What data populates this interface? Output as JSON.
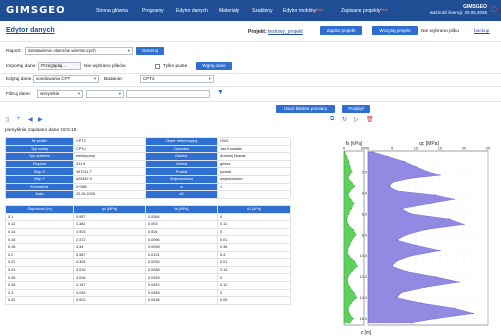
{
  "nav": {
    "logo": "GIMSGEO",
    "items": [
      {
        "label": "Strona główna",
        "badge": ""
      },
      {
        "label": "Programy",
        "badge": ""
      },
      {
        "label": "Edytor danych",
        "badge": ""
      },
      {
        "label": "Materiały",
        "badge": ""
      },
      {
        "label": "Szablony",
        "badge": ""
      },
      {
        "label": "Edytor mobilny",
        "badge": "Beta"
      },
      {
        "label": "Zapisane projekty",
        "badge": "Beta"
      }
    ],
    "brand_name": "GIMSGEO",
    "brand_sub": "ważność licencji: 20.06.2026"
  },
  "page": {
    "title": "Edytor danych",
    "project_label": "Projekt:",
    "project_name": "testowy_projekt",
    "save_button": "Zapisz projekt",
    "load_button": "Wczytaj projekt",
    "no_file": "Nie wybrano pliku",
    "backup": "backup"
  },
  "report": {
    "label": "Raport:",
    "value": "Zestawienie otworów wiertniczych",
    "generate": "Generuj"
  },
  "import": {
    "label": "Importuj dane:",
    "browse": "Przeglądaj...",
    "no_files": "Nie wybrano plików.",
    "only_empty": "Tylko puste",
    "load": "Wgraj dane"
  },
  "edit": {
    "label": "Edytuj dane:",
    "value": "sondowania CPT",
    "research_label": "Badanie:",
    "research_value": "CPT2"
  },
  "filter": {
    "label": "Filtruj dane:",
    "value": "wszystkie",
    "second": ""
  },
  "actions": {
    "remove_errors": "Usuń błędne pomiary",
    "sublayer": "Podpięł"
  },
  "icons": [
    "file-icon",
    "plus-icon",
    "arrow-left-icon",
    "arrow-right-icon",
    "copy-icon",
    "refresh-icon",
    "play-icon",
    "trash-icon"
  ],
  "saved_status": "pomyślnie zapisano dane 19:5:19",
  "info_table": [
    [
      "Nr profilu",
      "CPT2",
      "Otwór referencyjny",
      "OW1"
    ],
    [
      "Typ sondy",
      "CPTu",
      "Operator",
      "Jan Kowalski"
    ],
    [
      "Typ systemu",
      "elektryczny",
      "Nadzór",
      "Andrzej Nowak"
    ],
    [
      "Rzędna",
      "311.9",
      "Gmina",
      "gmina"
    ],
    [
      "Wsp X",
      "497011.7",
      "Powiat",
      "powiat"
    ],
    [
      "Wsp Y",
      "629487.9",
      "Województwo",
      "województwo"
    ],
    [
      "Kilometraż",
      "0+565",
      "a",
      "1"
    ],
    [
      "Data",
      "20.06.2028",
      "α0",
      ""
    ]
  ],
  "data_table": {
    "headers": [
      "Głębokość [m]",
      "qc [MPa]",
      "fs [MPa]",
      "u2 [kPa]"
    ],
    "rows": [
      [
        "0.1",
        "0.957",
        "0.0084",
        "0"
      ],
      [
        "0.12",
        "1.382",
        "0.003",
        "0.11"
      ],
      [
        "0.14",
        "1.903",
        "0.004",
        "0"
      ],
      [
        "0.16",
        "2.472",
        "0.0066",
        "0.01"
      ],
      [
        "0.18",
        "3.34",
        "0.0098",
        "0.35"
      ],
      [
        "0.2",
        "3.987",
        "0.0131",
        "0.4"
      ],
      [
        "0.22",
        "4.304",
        "0.0254",
        "0.01"
      ],
      [
        "0.24",
        "4.516",
        "0.0288",
        "0.13"
      ],
      [
        "0.26",
        "4.516",
        "0.0326",
        "0"
      ],
      [
        "0.28",
        "4.157",
        "0.0492",
        "0.12"
      ],
      [
        "0.3",
        "4.045",
        "0.0456",
        "0"
      ],
      [
        "0.32",
        "3.922",
        "0.0436",
        "0.05"
      ]
    ]
  },
  "chart_data": {
    "type": "area",
    "fs_label": "fs [kPa]",
    "qc_label": "qc [MPa]",
    "ylabel": "z [m]",
    "fs_ticks": [
      "0",
      "300"
    ],
    "qc_ticks": [
      "0",
      "5",
      "10",
      "15",
      "20",
      "25"
    ],
    "depth_ticks": [
      "2.0",
      "4.0",
      "6.0",
      "8.0",
      "10.0",
      "12.0",
      "14.0",
      "16.0"
    ],
    "ylim": [
      0,
      16.6
    ],
    "qc_xlim": [
      0,
      25
    ],
    "fs_xlim": [
      0,
      300
    ],
    "fs_color": "#34c434",
    "qc_color": "#6d63d8",
    "depth": [
      0.1,
      0.5,
      1.0,
      1.5,
      2.0,
      2.3,
      2.6,
      3.0,
      3.4,
      3.8,
      4.2,
      4.6,
      5.0,
      5.5,
      6.0,
      6.5,
      7.0,
      7.5,
      8.0,
      8.5,
      9.0,
      9.5,
      10.0,
      10.5,
      11.0,
      11.5,
      12.0,
      12.5,
      13.0,
      13.5,
      14.0,
      14.5,
      15.0,
      15.5,
      16.0,
      16.4
    ],
    "qc": [
      1.0,
      4.0,
      7.5,
      10.0,
      12.5,
      15.0,
      9.0,
      5.0,
      4.5,
      6.0,
      14.0,
      18.0,
      13.0,
      7.0,
      9.0,
      17.0,
      20.0,
      12.0,
      8.0,
      6.0,
      10.0,
      15.0,
      9.0,
      6.0,
      5.0,
      8.0,
      14.0,
      19.0,
      12.0,
      7.0,
      6.0,
      11.0,
      18.0,
      22.0,
      14.0,
      9.0
    ],
    "fs": [
      10,
      40,
      70,
      90,
      120,
      80,
      60,
      120,
      160,
      90,
      60,
      100,
      150,
      110,
      70,
      40,
      60,
      140,
      180,
      120,
      80,
      50,
      70,
      160,
      200,
      120,
      60,
      50,
      90,
      150,
      190,
      110,
      60,
      80,
      140,
      90
    ]
  }
}
